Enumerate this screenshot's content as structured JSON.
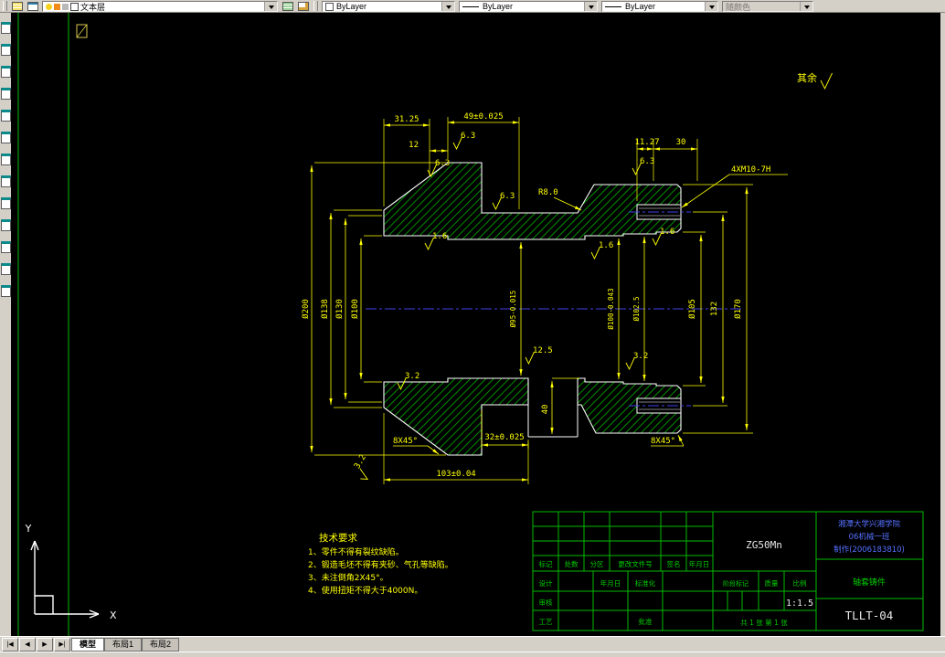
{
  "toolbar": {
    "layer_value": "文本层",
    "color_value": "ByLayer",
    "linetype_value": "ByLayer",
    "lineweight_value": "ByLayer",
    "plotstyle_value": "随颜色"
  },
  "tabs": {
    "nav": [
      "|◀",
      "◀",
      "▶",
      "▶|"
    ],
    "model": "模型",
    "layout1": "布局1",
    "layout2": "布局2"
  },
  "drawing": {
    "labels": {
      "rest": "其余",
      "x": "X",
      "y": "Y"
    },
    "dims": {
      "d3125": "31.25",
      "d12": "12",
      "d49": "49±0.025",
      "d1127": "11.27",
      "d30": "30",
      "thread": "4XM10-7H",
      "r8": "R8.0",
      "dia200": "Ø200",
      "dia138": "Ø138",
      "dia130": "Ø130",
      "dia100l": "Ø100",
      "dia95": "Ø95-0.015",
      "dia100r": "Ø100-0.043",
      "dia1025": "Ø102.5",
      "dia105": "Ø105",
      "d132": "132",
      "dia170": "Ø170",
      "d32": "32±0.025",
      "d40": "40",
      "d103": "103±0.04",
      "chamfer": "8X45°",
      "r63": "6.3",
      "r16": "1.6",
      "r32": "3.2",
      "r125": "12.5"
    },
    "notes": {
      "title": "技术要求",
      "l1": "1、零件不得有裂纹缺陷。",
      "l2": "2、锻造毛坯不得有夹砂、气孔等缺陷。",
      "l3": "3、未注倒角2X45°。",
      "l4": "4、使用扭矩不得大于4000N。"
    }
  },
  "titleblock": {
    "school": "湘潭大学兴湘学院",
    "class_line": "06机械一班",
    "id_line": "制作(2006183810)",
    "material": "ZG50Mn",
    "part_name": "轴套铸件",
    "drawing_no": "TLLT-04",
    "scale_value": "1:1.5",
    "sheet_note": "共 1 张  第 1 张",
    "headers": [
      "标记",
      "处数",
      "分区",
      "更改文件号",
      "签名",
      "年月日"
    ],
    "design": "设计",
    "date_label": "年月日",
    "standard": "标准化",
    "check": "审核",
    "process": "工艺",
    "approve": "批准",
    "stage": "阶段标记",
    "weight": "质量",
    "scale_label": "比例"
  }
}
